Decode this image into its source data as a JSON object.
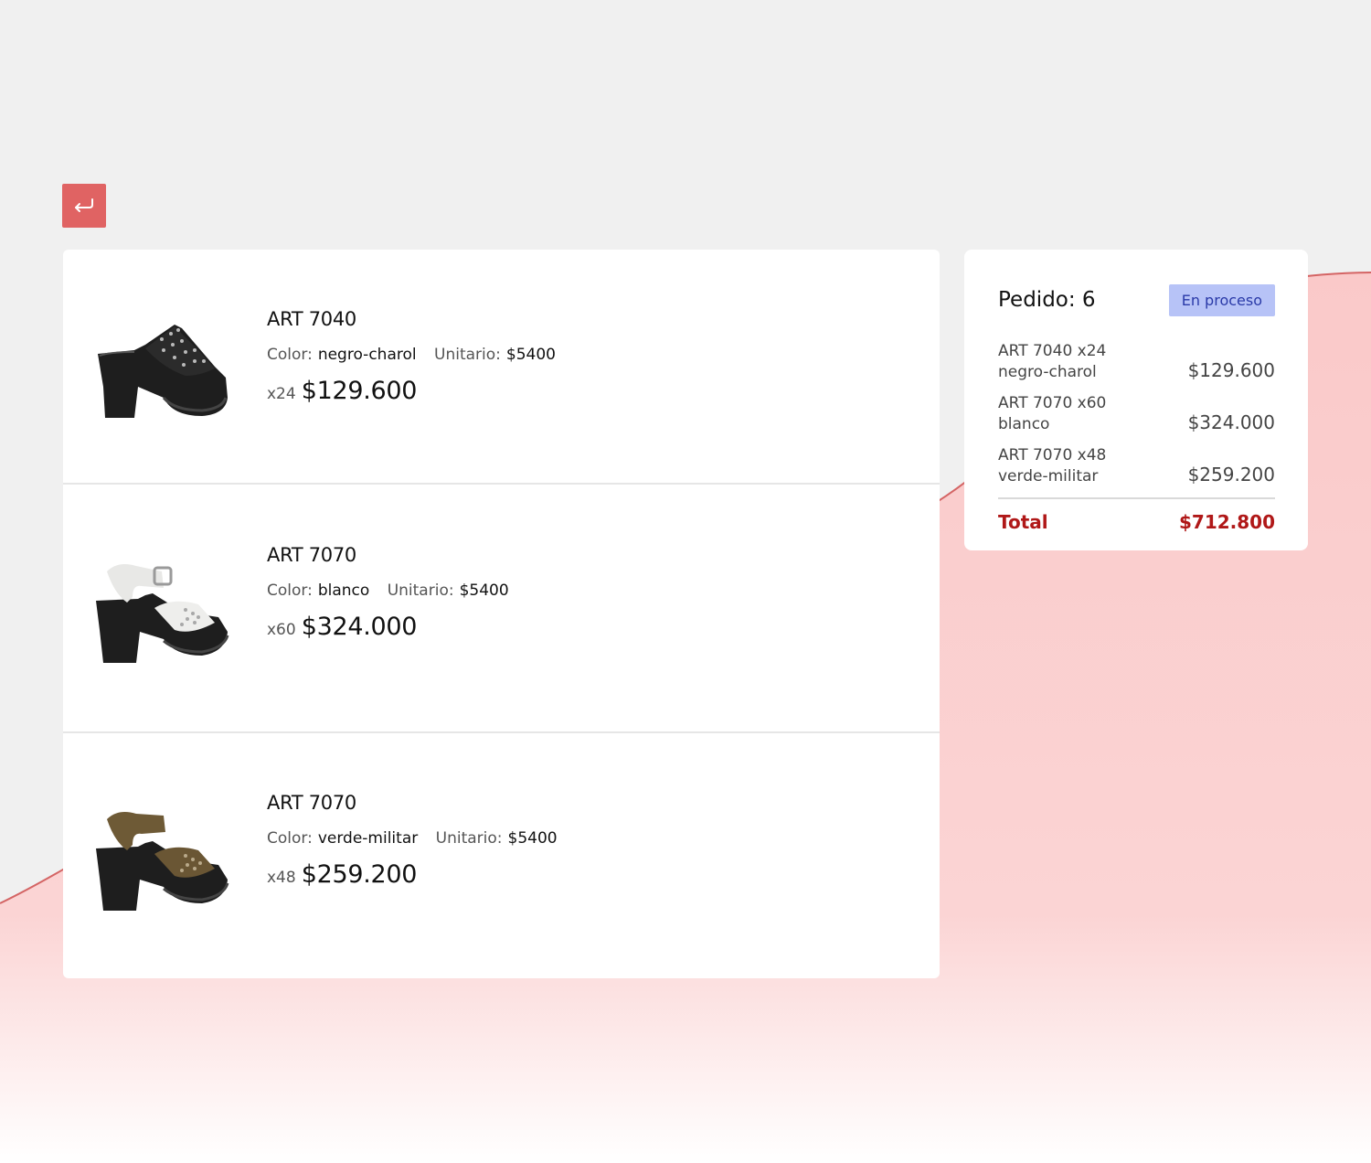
{
  "colors": {
    "accent": "#e06363",
    "total_red": "#b01818",
    "badge_bg": "#b7c3f7",
    "wave_pink": "#fac9c9"
  },
  "back_button": {
    "icon": "return-arrow-icon"
  },
  "items": [
    {
      "title": "ART 7040",
      "color_label": "Color:",
      "color_value": "negro-charol",
      "unit_label": "Unitario:",
      "unit_value": "$5400",
      "qty": "x24",
      "price": "$129.600",
      "image": "shoe-black-patent-icon"
    },
    {
      "title": "ART 7070",
      "color_label": "Color:",
      "color_value": "blanco",
      "unit_label": "Unitario:",
      "unit_value": "$5400",
      "qty": "x60",
      "price": "$324.000",
      "image": "shoe-white-icon"
    },
    {
      "title": "ART 7070",
      "color_label": "Color:",
      "color_value": "verde-militar",
      "unit_label": "Unitario:",
      "unit_value": "$5400",
      "qty": "x48",
      "price": "$259.200",
      "image": "shoe-olive-icon"
    }
  ],
  "summary": {
    "title": "Pedido: 6",
    "status": "En proceso",
    "lines": [
      {
        "art": "ART 7040 x24",
        "color": "negro-charol",
        "amount": "$129.600"
      },
      {
        "art": "ART 7070 x60",
        "color": "blanco",
        "amount": "$324.000"
      },
      {
        "art": "ART 7070 x48",
        "color": "verde-militar",
        "amount": "$259.200"
      }
    ],
    "total_label": "Total",
    "total_value": "$712.800"
  }
}
